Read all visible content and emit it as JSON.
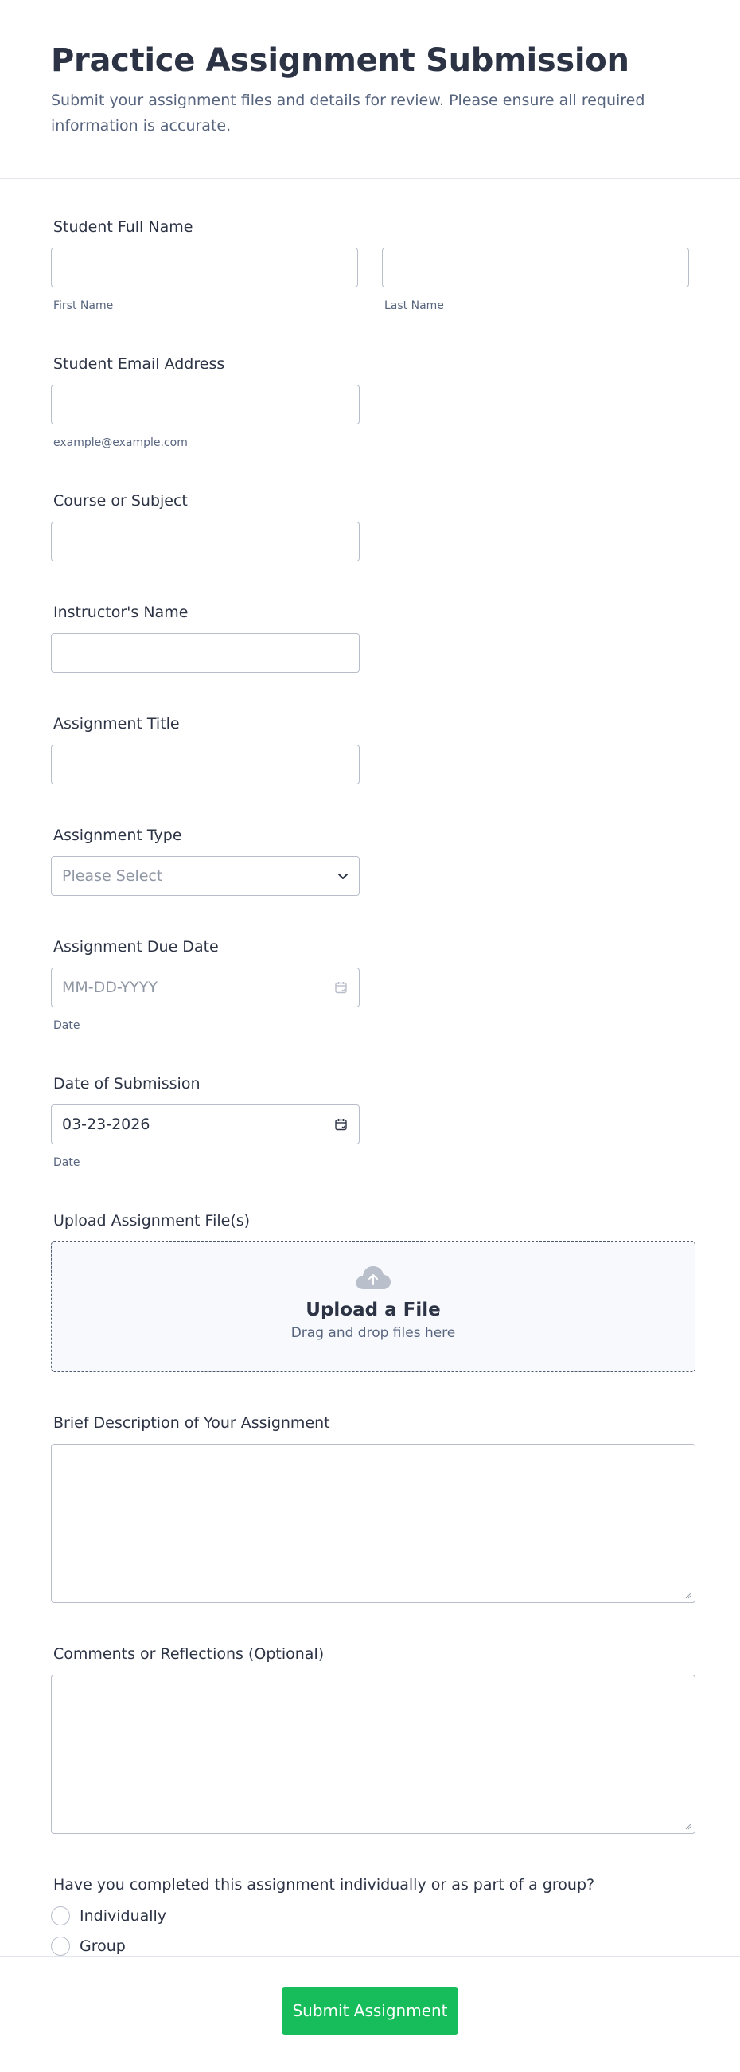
{
  "header": {
    "title": "Practice Assignment Submission",
    "subtitle": "Submit your assignment files and details for review. Please ensure all required information is accurate."
  },
  "fields": {
    "full_name": {
      "label": "Student Full Name",
      "first_sublabel": "First Name",
      "last_sublabel": "Last Name",
      "first_value": "",
      "last_value": ""
    },
    "email": {
      "label": "Student Email Address",
      "sublabel": "example@example.com",
      "value": ""
    },
    "course": {
      "label": "Course or Subject",
      "value": ""
    },
    "instructor": {
      "label": "Instructor's Name",
      "value": ""
    },
    "assignment_title": {
      "label": "Assignment Title",
      "value": ""
    },
    "assignment_type": {
      "label": "Assignment Type",
      "placeholder": "Please Select"
    },
    "due_date": {
      "label": "Assignment Due Date",
      "placeholder": "MM-DD-YYYY",
      "sublabel": "Date"
    },
    "submission_date": {
      "label": "Date of Submission",
      "value": "03-23-2026",
      "sublabel": "Date"
    },
    "upload": {
      "label": "Upload Assignment File(s)",
      "title": "Upload a File",
      "subtitle": "Drag and drop files here"
    },
    "description": {
      "label": "Brief Description of Your Assignment",
      "value": ""
    },
    "comments": {
      "label": "Comments or Reflections (Optional)",
      "value": ""
    },
    "group": {
      "label": "Have you completed this assignment individually or as part of a group?",
      "options": [
        "Individually",
        "Group"
      ]
    }
  },
  "footer": {
    "submit_label": "Submit Assignment"
  },
  "colors": {
    "accent": "#18bd5b",
    "text": "#2c3345",
    "muted": "#57647e",
    "border": "#b8bdc9"
  },
  "icons": {
    "select": "chevron-down-icon",
    "date": "calendar-icon",
    "upload": "cloud-upload-icon"
  }
}
